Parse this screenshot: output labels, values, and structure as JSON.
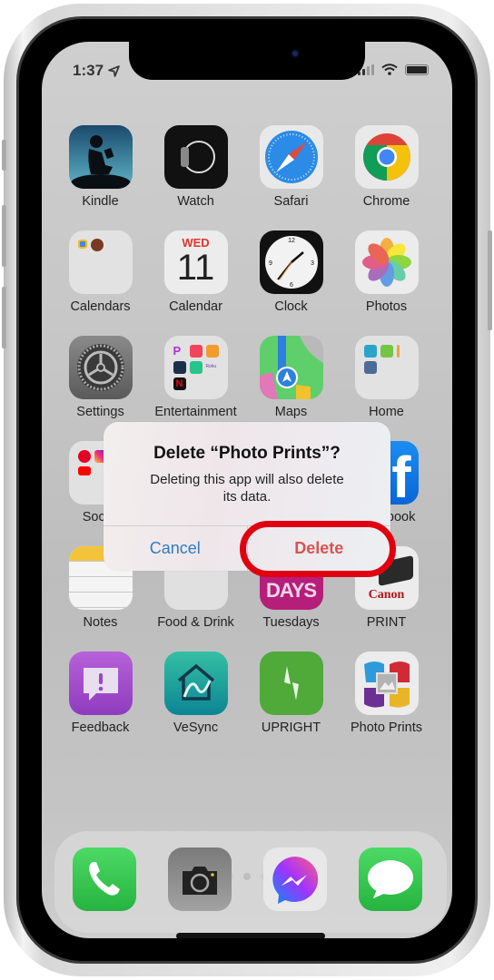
{
  "status_bar": {
    "time": "1:37",
    "location_icon": "location-arrow-icon",
    "signal": "signal-icon",
    "wifi": "wifi-icon",
    "battery": "battery-icon"
  },
  "apps": [
    {
      "label": "Kindle",
      "icon": "kindle-icon"
    },
    {
      "label": "Watch",
      "icon": "watch-icon"
    },
    {
      "label": "Safari",
      "icon": "safari-icon"
    },
    {
      "label": "Chrome",
      "icon": "chrome-icon"
    },
    {
      "label": "Calendars",
      "icon": "folder-icon"
    },
    {
      "label": "Calendar",
      "icon": "calendar-icon",
      "day": "WED",
      "date": "11"
    },
    {
      "label": "Clock",
      "icon": "clock-icon"
    },
    {
      "label": "Photos",
      "icon": "photos-icon"
    },
    {
      "label": "Settings",
      "icon": "settings-icon"
    },
    {
      "label": "Entertainment",
      "icon": "folder-icon"
    },
    {
      "label": "Maps",
      "icon": "maps-icon"
    },
    {
      "label": "Home",
      "icon": "folder-icon"
    },
    {
      "label": "Social",
      "icon": "folder-icon"
    },
    {
      "label": "",
      "icon": "hidden"
    },
    {
      "label": "",
      "icon": "hidden"
    },
    {
      "label": "Facebook",
      "icon": "facebook-icon"
    },
    {
      "label": "Notes",
      "icon": "notes-icon"
    },
    {
      "label": "Food & Drink",
      "icon": "folder-icon"
    },
    {
      "label": "Tuesdays",
      "icon": "tuesdays-icon",
      "badge_text": "DAYS"
    },
    {
      "label": "PRINT",
      "icon": "canon-print-icon",
      "brand": "Canon"
    },
    {
      "label": "Feedback",
      "icon": "feedback-icon"
    },
    {
      "label": "VeSync",
      "icon": "vesync-icon"
    },
    {
      "label": "UPRIGHT",
      "icon": "upright-icon"
    },
    {
      "label": "Photo Prints",
      "icon": "photo-prints-icon"
    }
  ],
  "page_dots": {
    "count": 3,
    "active": 2
  },
  "dock": [
    {
      "name": "Phone",
      "icon": "phone-icon"
    },
    {
      "name": "Camera",
      "icon": "camera-icon"
    },
    {
      "name": "Messenger",
      "icon": "messenger-icon"
    },
    {
      "name": "Messages",
      "icon": "messages-icon"
    }
  ],
  "dialog": {
    "title": "Delete “Photo Prints”?",
    "message": "Deleting this app will also delete its data.",
    "cancel_label": "Cancel",
    "delete_label": "Delete"
  },
  "colors": {
    "accent_blue": "#2e7cc5",
    "destructive_red": "#d9534f",
    "highlight_red": "#e00010"
  }
}
